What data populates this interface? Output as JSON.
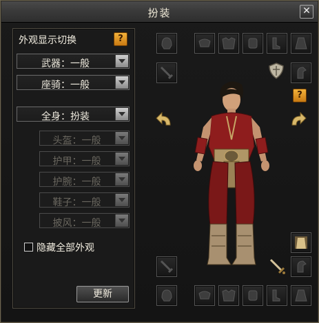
{
  "window": {
    "title": "扮装",
    "close_glyph": "✕"
  },
  "left_panel": {
    "header": "外观显示切换",
    "help_glyph": "?",
    "weapon_dropdown": "武器：一般",
    "mount_dropdown": "座骑：一般",
    "fullbody_dropdown": "全身：扮装",
    "part_dropdowns": [
      {
        "label": "头盔：一般",
        "enabled": false
      },
      {
        "label": "护甲：一般",
        "enabled": false
      },
      {
        "label": "护腕：一般",
        "enabled": false
      },
      {
        "label": "鞋子：一般",
        "enabled": false
      },
      {
        "label": "披风：一般",
        "enabled": false
      }
    ],
    "hide_all_label": "隐藏全部外观",
    "hide_all_checked": false,
    "update_button": "更新"
  },
  "preview": {
    "help_glyph": "?",
    "top_slots": [
      "helmet-slot",
      "shoulder-slot",
      "armor-slot",
      "bracer-slot",
      "boots-slot",
      "cloak-slot"
    ],
    "bottom_slots": [
      "helmet-slot",
      "shoulder-slot",
      "armor-slot",
      "bracer-slot",
      "boots-slot",
      "cloak-slot"
    ],
    "side_slots": [
      "weapon-slot",
      "mount-slot",
      "costume-slot",
      "weapon-costume-slot",
      "mount-costume-slot",
      "face-slot"
    ]
  },
  "colors": {
    "help_orange": "#e39a24",
    "text": "#f0ece0",
    "disabled_text": "#6a675f",
    "outfit_red": "#8e1d1d",
    "gold_trim": "#c6a566"
  }
}
